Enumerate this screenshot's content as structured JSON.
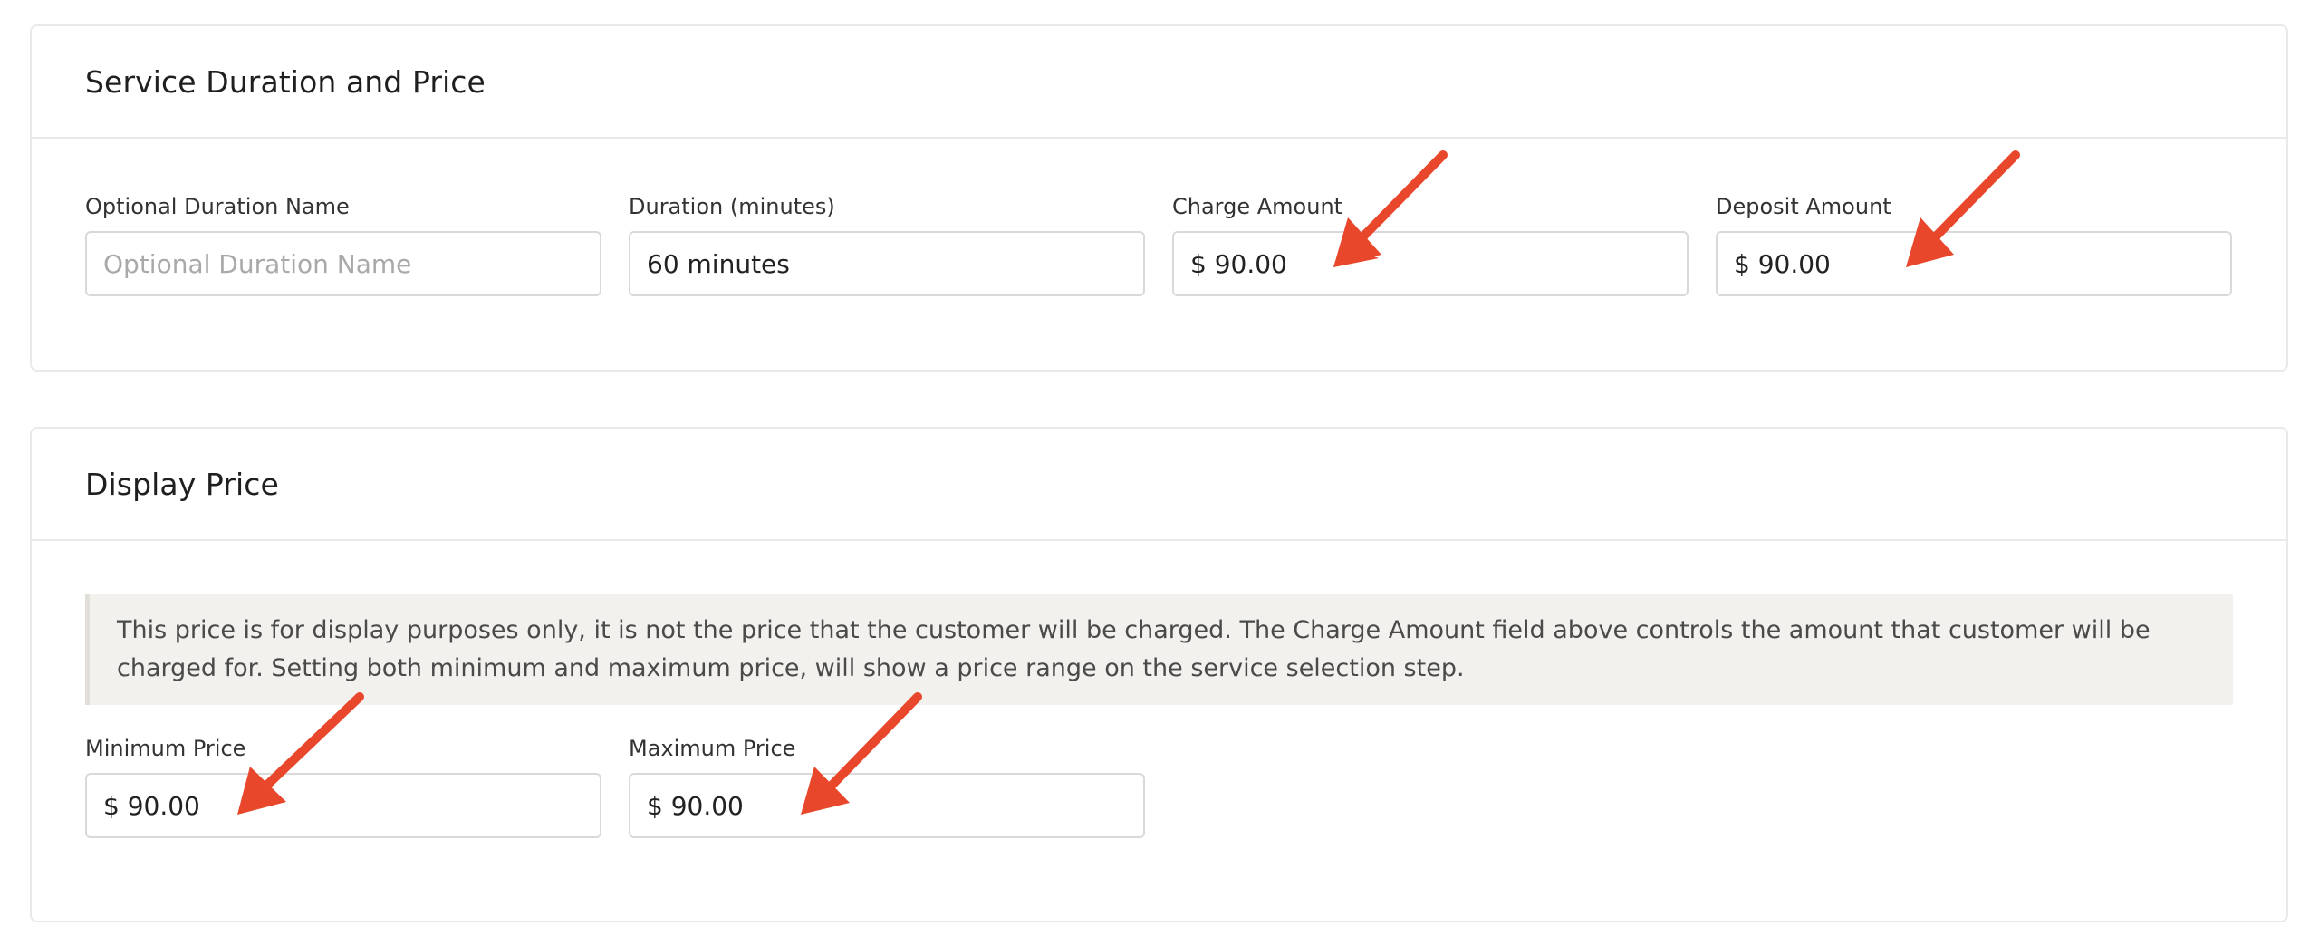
{
  "duration_section": {
    "title": "Service Duration and Price",
    "fields": {
      "optional_name": {
        "label": "Optional Duration Name",
        "value": "",
        "placeholder": "Optional Duration Name"
      },
      "duration": {
        "label": "Duration (minutes)",
        "value": "60 minutes"
      },
      "charge": {
        "label": "Charge Amount",
        "value": "$ 90.00"
      },
      "deposit": {
        "label": "Deposit Amount",
        "value": "$ 90.00"
      }
    }
  },
  "display_price_section": {
    "title": "Display Price",
    "notice": "This price is for display purposes only, it is not the price that the customer will be charged. The Charge Amount field above controls the amount that customer will be charged for. Setting both minimum and maximum price, will show a price range on the service selection step.",
    "fields": {
      "min_price": {
        "label": "Minimum Price",
        "value": "$ 90.00"
      },
      "max_price": {
        "label": "Maximum Price",
        "value": "$ 90.00"
      }
    }
  },
  "colors": {
    "annotation_arrow": "#e8472c",
    "border": "#e9e9e9",
    "notice_bg": "#f3f1ed"
  }
}
